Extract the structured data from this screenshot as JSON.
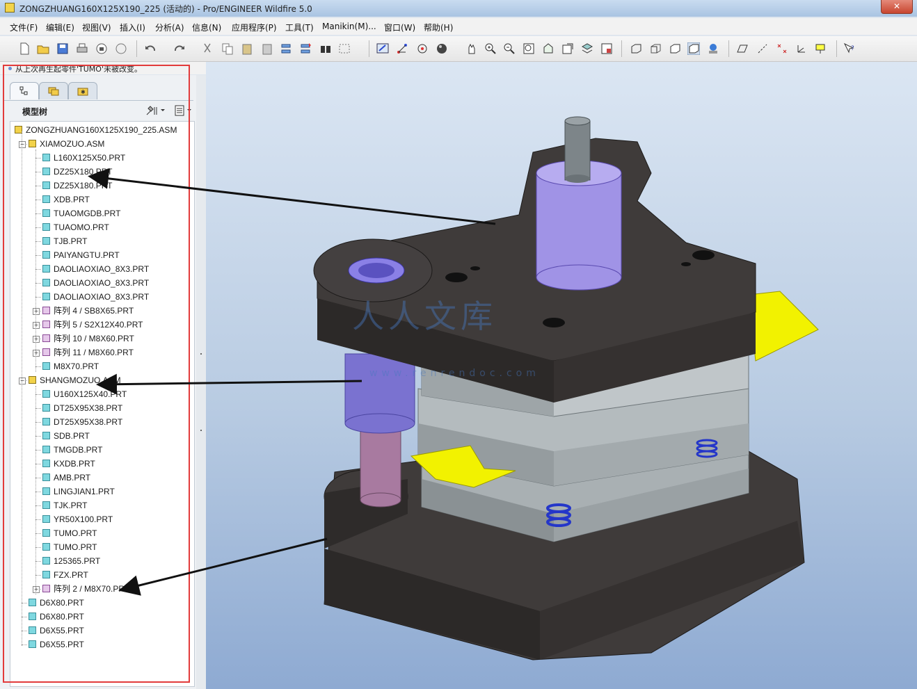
{
  "window": {
    "title": "ZONGZHUANG160X125X190_225 (活动的) - Pro/ENGINEER Wildfire 5.0"
  },
  "menu": [
    {
      "label": "文件(F)"
    },
    {
      "label": "编辑(E)"
    },
    {
      "label": "视图(V)"
    },
    {
      "label": "插入(I)"
    },
    {
      "label": "分析(A)"
    },
    {
      "label": "信息(N)"
    },
    {
      "label": "应用程序(P)"
    },
    {
      "label": "工具(T)"
    },
    {
      "label": "Manikin(M)..."
    },
    {
      "label": "窗口(W)"
    },
    {
      "label": "帮助(H)"
    }
  ],
  "message": "从上次再生起零件'TUMO'未被改变。",
  "model_tree": {
    "title": "模型树",
    "root": "ZONGZHUANG160X125X190_225.ASM",
    "nodes": [
      {
        "label": "XIAMOZUO.ASM",
        "type": "asm"
      },
      {
        "label": "L160X125X50.PRT",
        "type": "part"
      },
      {
        "label": "DZ25X180.PRT",
        "type": "part"
      },
      {
        "label": "DZ25X180.PRT",
        "type": "part"
      },
      {
        "label": "XDB.PRT",
        "type": "part"
      },
      {
        "label": "TUAOMGDB.PRT",
        "type": "part"
      },
      {
        "label": "TUAOMO.PRT",
        "type": "part"
      },
      {
        "label": "TJB.PRT",
        "type": "part"
      },
      {
        "label": "PAIYANGTU.PRT",
        "type": "part"
      },
      {
        "label": "DAOLIAOXIAO_8X3.PRT",
        "type": "part"
      },
      {
        "label": "DAOLIAOXIAO_8X3.PRT",
        "type": "part"
      },
      {
        "label": "DAOLIAOXIAO_8X3.PRT",
        "type": "part"
      },
      {
        "label": "阵列 4 / SB8X65.PRT",
        "type": "pattern"
      },
      {
        "label": "阵列 5 / S2X12X40.PRT",
        "type": "pattern"
      },
      {
        "label": "阵列 10 / M8X60.PRT",
        "type": "pattern"
      },
      {
        "label": "阵列 11 / M8X60.PRT",
        "type": "pattern"
      },
      {
        "label": "M8X70.PRT",
        "type": "part"
      },
      {
        "label": "SHANGMOZUO.ASM",
        "type": "asm"
      },
      {
        "label": "U160X125X40.PRT",
        "type": "part"
      },
      {
        "label": "DT25X95X38.PRT",
        "type": "part"
      },
      {
        "label": "DT25X95X38.PRT",
        "type": "part"
      },
      {
        "label": "SDB.PRT",
        "type": "part"
      },
      {
        "label": "TMGDB.PRT",
        "type": "part"
      },
      {
        "label": "KXDB.PRT",
        "type": "part"
      },
      {
        "label": "AMB.PRT",
        "type": "part"
      },
      {
        "label": "LINGJIAN1.PRT",
        "type": "part"
      },
      {
        "label": "TJK.PRT",
        "type": "part"
      },
      {
        "label": "YR50X100.PRT",
        "type": "part"
      },
      {
        "label": "TUMO.PRT",
        "type": "part"
      },
      {
        "label": "TUMO.PRT",
        "type": "part"
      },
      {
        "label": "125365.PRT",
        "type": "part"
      },
      {
        "label": "FZX.PRT",
        "type": "part"
      },
      {
        "label": "阵列 2 / M8X70.PRT",
        "type": "pattern"
      },
      {
        "label": "D6X80.PRT",
        "type": "part"
      },
      {
        "label": "D6X80.PRT",
        "type": "part"
      },
      {
        "label": "D6X55.PRT",
        "type": "part"
      },
      {
        "label": "D6X55.PRT",
        "type": "part"
      }
    ]
  },
  "watermark": {
    "text": "人人文库",
    "url": "www.renrendoc.com"
  },
  "colors": {
    "annotation": "#e23b3b",
    "die_dark": "#3f3b3a",
    "plate_gray": "#a9b0b3",
    "guide_purple": "#9a8fe0",
    "spring_blue": "#2436c9",
    "strip_yellow": "#f2f200"
  }
}
